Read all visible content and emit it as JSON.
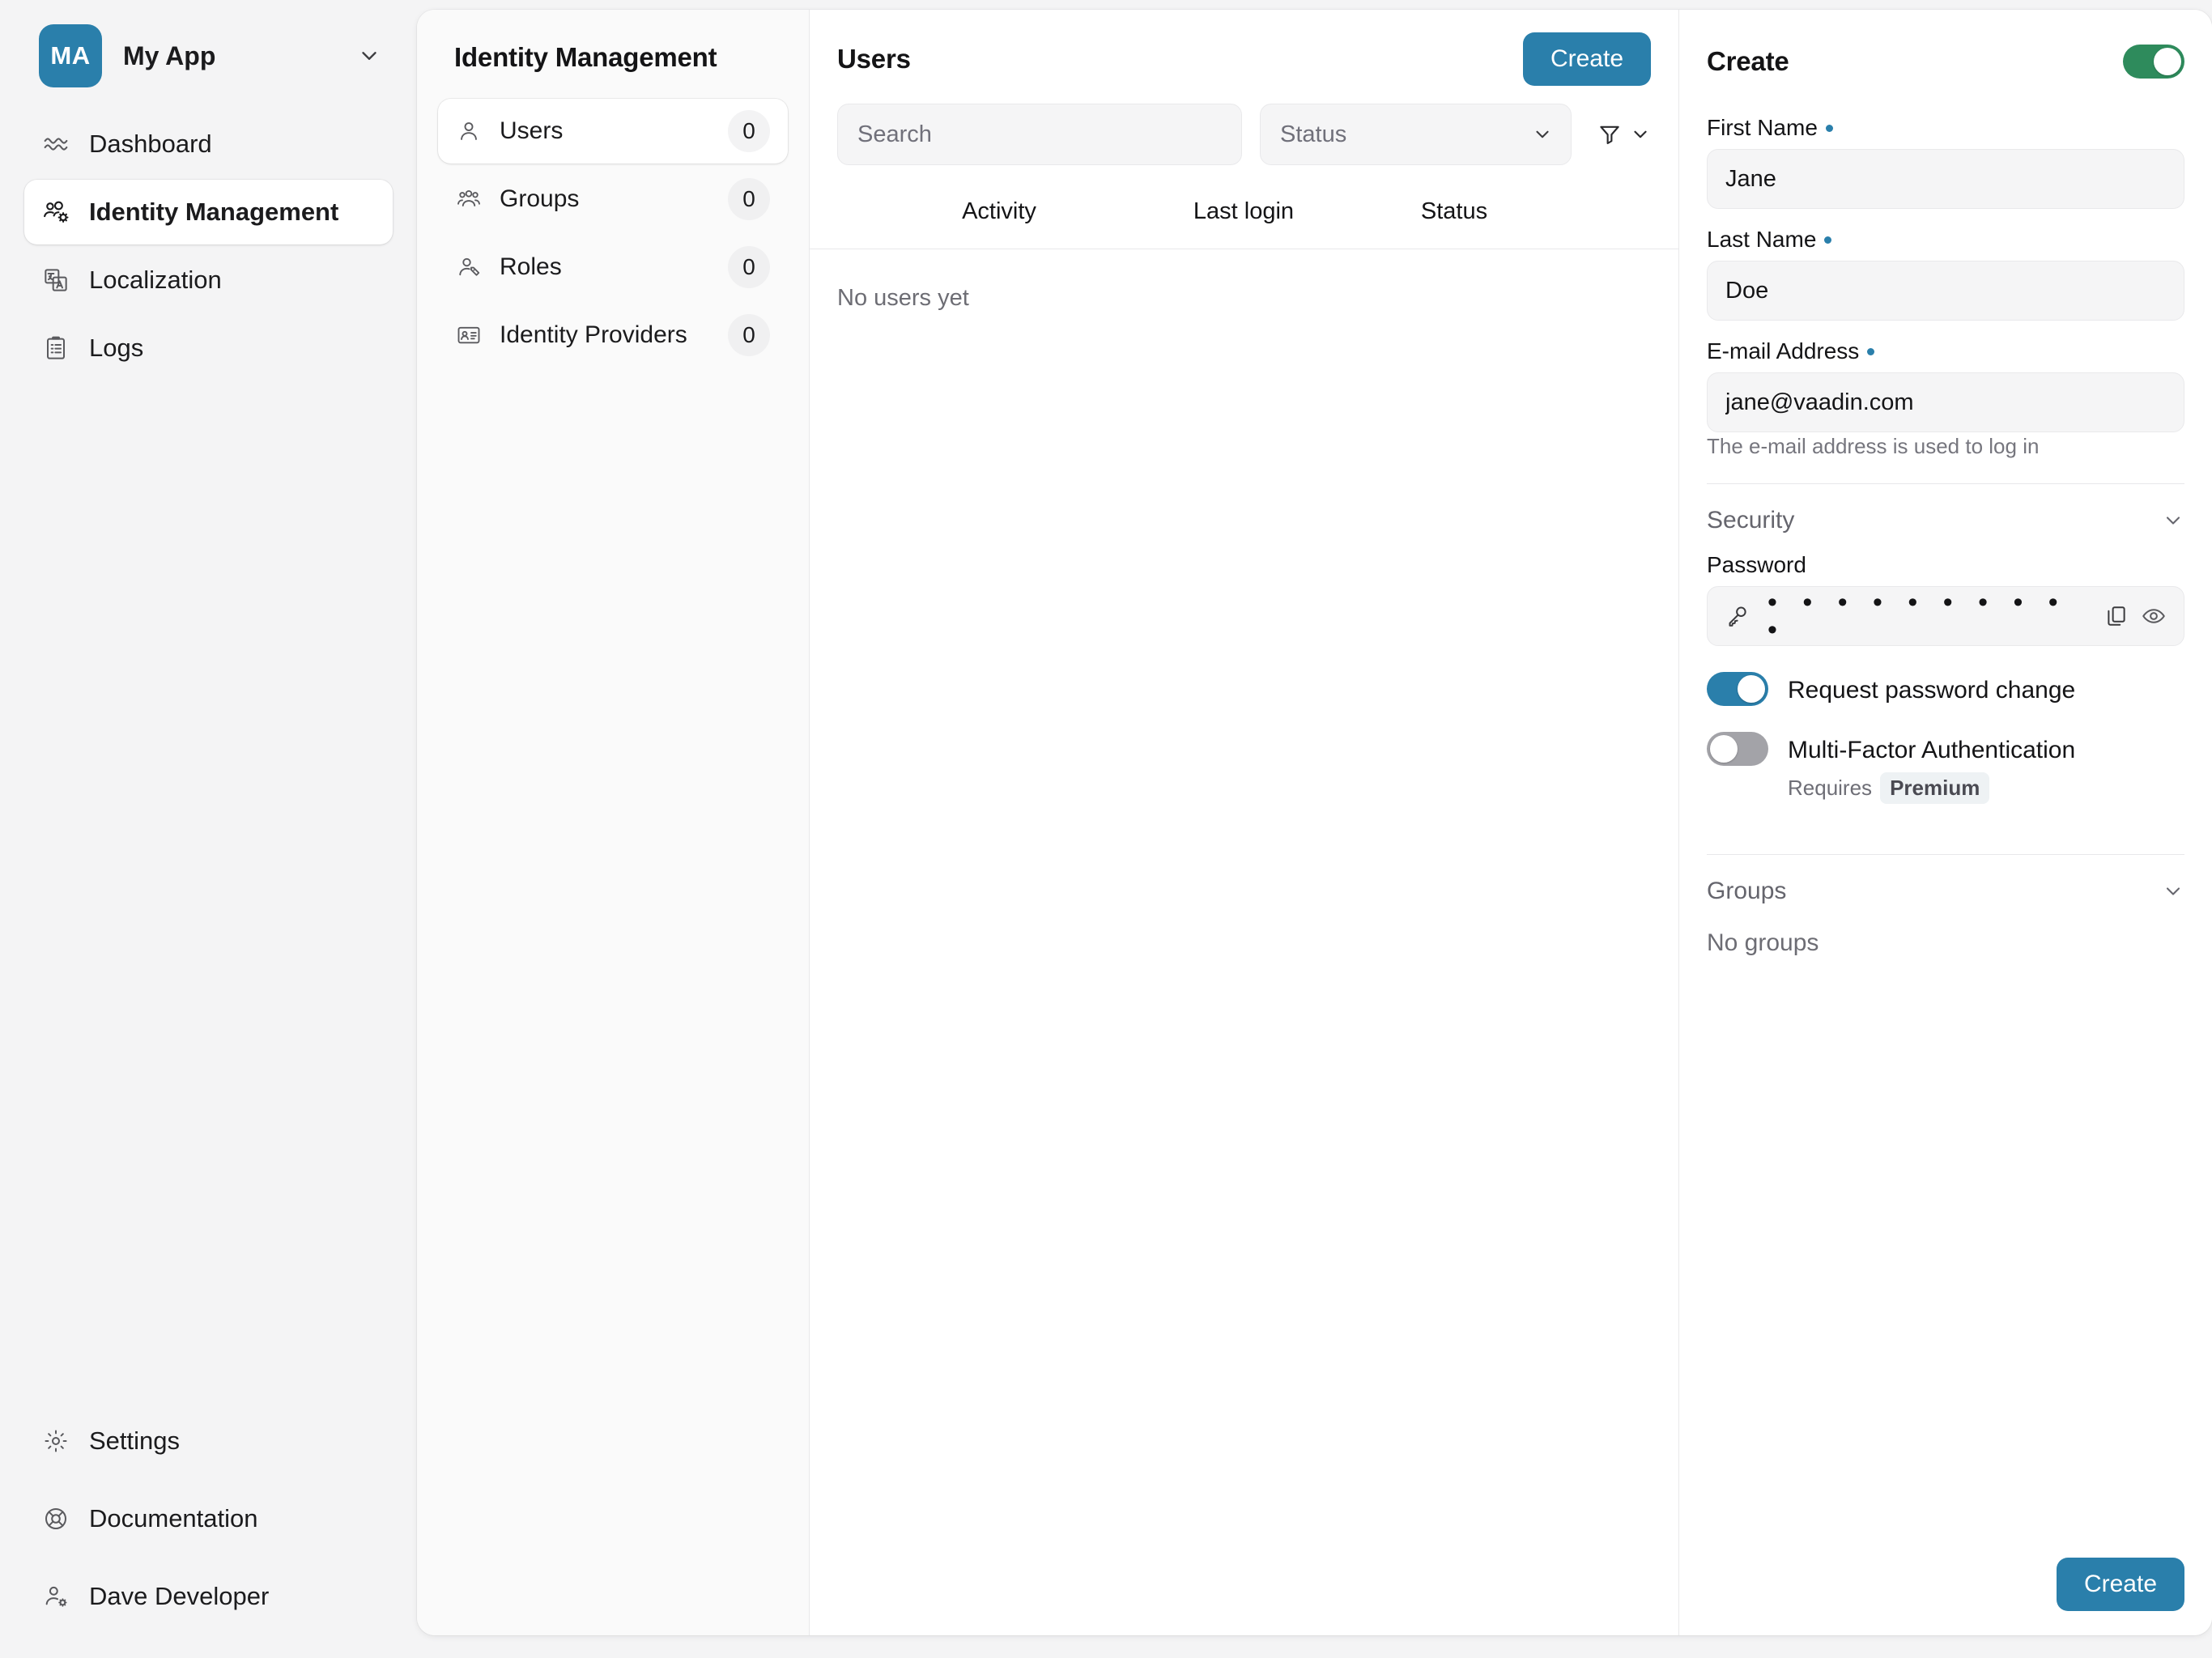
{
  "sidebar": {
    "brand": {
      "initials": "MA",
      "name": "My App",
      "chevron_icon": "chevron-down-icon"
    },
    "items": [
      {
        "label": "Dashboard",
        "icon": "chart-line-icon",
        "active": false
      },
      {
        "label": "Identity Management",
        "icon": "users-gear-icon",
        "active": true
      },
      {
        "label": "Localization",
        "icon": "translate-icon",
        "active": false
      },
      {
        "label": "Logs",
        "icon": "clipboard-list-icon",
        "active": false
      }
    ],
    "bottom_items": [
      {
        "label": "Settings",
        "icon": "gear-icon"
      },
      {
        "label": "Documentation",
        "icon": "lifebuoy-icon"
      },
      {
        "label": "Dave Developer",
        "icon": "user-gear-icon"
      }
    ]
  },
  "identity_nav": {
    "title": "Identity Management",
    "items": [
      {
        "label": "Users",
        "count": "0",
        "icon": "user-icon",
        "active": true
      },
      {
        "label": "Groups",
        "count": "0",
        "icon": "users-icon",
        "active": false
      },
      {
        "label": "Roles",
        "count": "0",
        "icon": "user-tag-icon",
        "active": false
      },
      {
        "label": "Identity Providers",
        "count": "0",
        "icon": "id-card-icon",
        "active": false
      }
    ]
  },
  "users_panel": {
    "title": "Users",
    "create_label": "Create",
    "search": {
      "placeholder": "Search",
      "value": ""
    },
    "status_select": {
      "label": "Status",
      "value": "",
      "chevron_icon": "chevron-down-icon"
    },
    "filter_icon": "funnel-icon",
    "filter_chevron_icon": "chevron-down-icon",
    "columns": [
      "Activity",
      "Last login",
      "Status"
    ],
    "empty_message": "No users yet",
    "rows": []
  },
  "detail_panel": {
    "title": "Create",
    "enabled_toggle": {
      "state": "on",
      "color": "#2E8B5C"
    },
    "fields": [
      {
        "label": "First Name",
        "required": true,
        "value": "Jane"
      },
      {
        "label": "Last Name",
        "required": true,
        "value": "Doe"
      },
      {
        "label": "E-mail Address",
        "required": true,
        "value": "jane@vaadin.com",
        "help": "The e-mail address is used to log in"
      }
    ],
    "security": {
      "section_label": "Security",
      "collapse_icon": "chevron-down-icon",
      "password_label": "Password",
      "password_masked": "• • • • • • • • • •",
      "key_icon": "key-icon",
      "copy_icon": "copy-icon",
      "reveal_icon": "eye-icon",
      "request_change": {
        "label": "Request password change",
        "state": "on",
        "color": "#2A7FAB"
      },
      "mfa": {
        "label": "Multi-Factor Authentication",
        "state": "off",
        "requires_prefix": "Requires",
        "requires_badge": "Premium"
      }
    },
    "groups": {
      "section_label": "Groups",
      "collapse_icon": "chevron-down-icon",
      "empty_message": "No groups"
    },
    "submit_label": "Create"
  },
  "colors": {
    "accent": "#2A7FAB",
    "success": "#2E8B5C",
    "page_bg": "#F4F4F5",
    "panel_bg": "#FAFAFA"
  }
}
